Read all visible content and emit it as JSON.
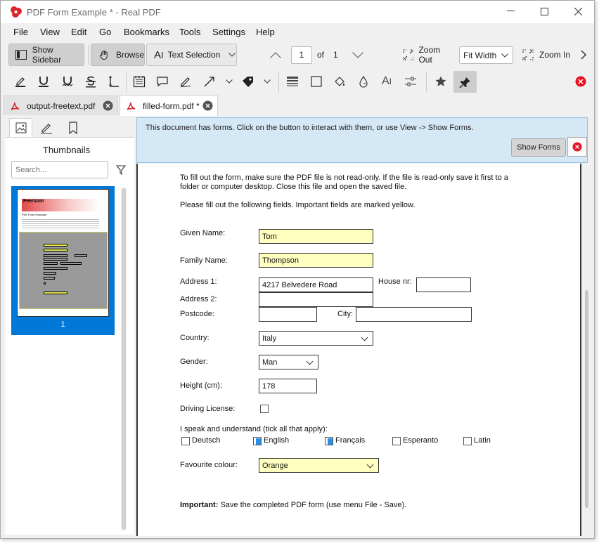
{
  "window": {
    "title": "PDF Form Example * - Real PDF"
  },
  "menu": [
    "File",
    "View",
    "Edit",
    "Go",
    "Bookmarks",
    "Tools",
    "Settings",
    "Help"
  ],
  "toolbar": {
    "show_sidebar": "Show Sidebar",
    "browse": "Browse",
    "text_selection": "Text Selection",
    "page_number": "1",
    "page_of": "of",
    "page_total": "1",
    "zoom_out": "Zoom Out",
    "zoom_level": "Fit Width",
    "zoom_in": "Zoom In"
  },
  "tabs": [
    {
      "label": "output-freetext.pdf"
    },
    {
      "label": "filled-form.pdf *"
    }
  ],
  "sidebar": {
    "title": "Thumbnails",
    "search_placeholder": "Search...",
    "page_label": "1",
    "thumb_title": "Feersom",
    "thumb_heading": "PDF Form Example"
  },
  "banner": {
    "message": "This document has forms. Click on the button to interact with them, or use View -> Show Forms.",
    "button": "Show Forms"
  },
  "document": {
    "intro1": "To fill out the form, make sure the PDF file is not read-only. If the file is read-only save it first to a",
    "intro2": "folder or computer desktop. Close this file and open the saved file.",
    "intro3": "Please fill out the following fields. Important fields are marked yellow.",
    "given_name_label": "Given Name:",
    "given_name": "Tom",
    "family_name_label": "Family Name:",
    "family_name": "Thompson",
    "address1_label": "Address 1:",
    "address1": "4217 Belvedere Road",
    "house_nr_label": "House nr:",
    "address2_label": "Address 2:",
    "postcode_label": "Postcode:",
    "city_label": "City:",
    "country_label": "Country:",
    "country": "Italy",
    "gender_label": "Gender:",
    "gender": "Man",
    "height_label": "Height (cm):",
    "height": "178",
    "driving_label": "Driving License:",
    "languages_label": "I speak and understand (tick all that apply):",
    "languages": [
      {
        "label": "Deutsch",
        "checked": false
      },
      {
        "label": "English",
        "checked": true
      },
      {
        "label": "Français",
        "checked": true
      },
      {
        "label": "Esperanto",
        "checked": false
      },
      {
        "label": "Latin",
        "checked": false
      }
    ],
    "colour_label": "Favourite colour:",
    "colour": "Orange",
    "important_bold": "Important:",
    "important_text": " Save the completed PDF form (use menu File - Save)."
  },
  "colors": {
    "accent": "#0078d7",
    "banner_bg": "#d5e8f5",
    "field_yellow": "#ffffc0"
  }
}
